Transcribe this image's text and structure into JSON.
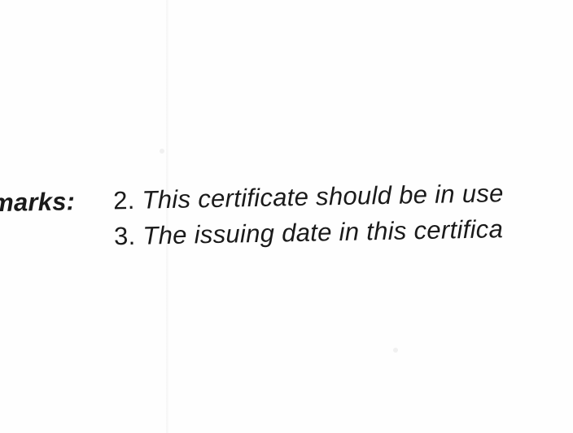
{
  "remarks": {
    "label": "marks:",
    "items": [
      {
        "number": "2.",
        "text": "This certificate should be in use"
      },
      {
        "number": "3.",
        "text": "The issuing date in this certifica"
      }
    ]
  }
}
